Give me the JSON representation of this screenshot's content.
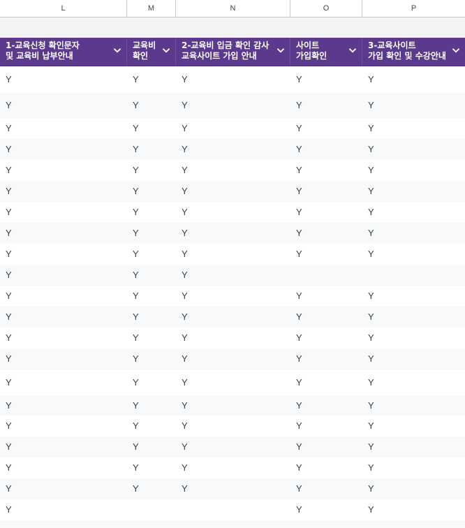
{
  "column_letters": [
    "L",
    "M",
    "N",
    "O",
    "P"
  ],
  "headers": [
    {
      "line1": "1-교육신청 확인문자",
      "line2": " 및 교육비 납부안내"
    },
    {
      "line1": "교육비",
      "line2": "확인"
    },
    {
      "line1": "2-교육비 입금 확인 감사",
      "line2": "교육사이트 가입 안내"
    },
    {
      "line1": "사이트",
      "line2": "가입확인"
    },
    {
      "line1": "3-교육사이트",
      "line2": "가입 확인 및 수강안내"
    }
  ],
  "rows": [
    {
      "L": "Y",
      "M": "Y",
      "N": "Y",
      "O": "Y",
      "P": "Y"
    },
    {
      "L": "Y",
      "M": "Y",
      "N": "Y",
      "O": "Y",
      "P": "Y"
    },
    {
      "L": "Y",
      "M": "Y",
      "N": "Y",
      "O": "Y",
      "P": "Y"
    },
    {
      "L": "Y",
      "M": "Y",
      "N": "Y",
      "O": "Y",
      "P": "Y"
    },
    {
      "L": "Y",
      "M": "Y",
      "N": "Y",
      "O": "Y",
      "P": "Y"
    },
    {
      "L": "Y",
      "M": "Y",
      "N": "Y",
      "O": "Y",
      "P": "Y"
    },
    {
      "L": "Y",
      "M": "Y",
      "N": "Y",
      "O": "Y",
      "P": "Y"
    },
    {
      "L": "Y",
      "M": "Y",
      "N": "Y",
      "O": "Y",
      "P": "Y"
    },
    {
      "L": "Y",
      "M": "Y",
      "N": "Y",
      "O": "Y",
      "P": "Y"
    },
    {
      "L": "Y",
      "M": "Y",
      "N": "Y",
      "O": "",
      "P": ""
    },
    {
      "L": "Y",
      "M": "Y",
      "N": "Y",
      "O": "Y",
      "P": "Y"
    },
    {
      "L": "Y",
      "M": "Y",
      "N": "Y",
      "O": "Y",
      "P": "Y"
    },
    {
      "L": "Y",
      "M": "Y",
      "N": "Y",
      "O": "Y",
      "P": "Y"
    },
    {
      "L": "Y",
      "M": "Y",
      "N": "Y",
      "O": "Y",
      "P": "Y"
    },
    {
      "L": "Y",
      "M": "Y",
      "N": "Y",
      "O": "Y",
      "P": "Y"
    },
    {
      "L": "Y",
      "M": "Y",
      "N": "Y",
      "O": "Y",
      "P": "Y"
    },
    {
      "L": "Y",
      "M": "Y",
      "N": "Y",
      "O": "Y",
      "P": "Y"
    },
    {
      "L": "Y",
      "M": "Y",
      "N": "Y",
      "O": "Y",
      "P": "Y"
    },
    {
      "L": "Y",
      "M": "Y",
      "N": "Y",
      "O": "Y",
      "P": "Y"
    },
    {
      "L": "Y",
      "M": "Y",
      "N": "Y",
      "O": "Y",
      "P": "Y"
    },
    {
      "L": "Y",
      "M": "",
      "N": "",
      "O": "Y",
      "P": "Y"
    },
    {
      "L": "",
      "M": "",
      "N": "",
      "O": "",
      "P": ""
    }
  ],
  "icons": {
    "filter": "chevron-down-icon"
  }
}
